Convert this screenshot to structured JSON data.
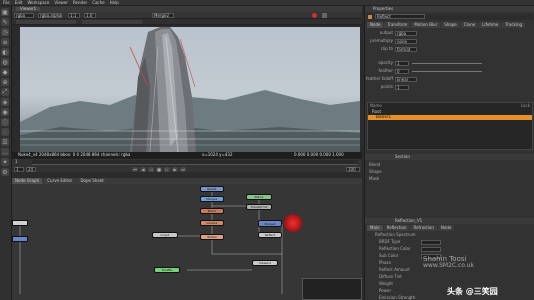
{
  "menubar": {
    "items": [
      "File",
      "Edit",
      "Workspace",
      "Viewer",
      "Render",
      "Cache",
      "Help"
    ]
  },
  "viewer": {
    "tab": "Viewer1",
    "channel_label": "rgba",
    "alpha_label": "rgba.alpha",
    "zoom_label": "1:1",
    "exposure_label": "1.0",
    "merge_label": "Merge2",
    "info_bar": "Nuke4_v4 2048x864  bbox: 0 0 2048 864 channels: rgba",
    "coords_text": "x=1024 y=432",
    "values_text": "0.000  0.000  0.000  1.000",
    "frame": "1"
  },
  "timeline": {
    "start": "1",
    "end": "100",
    "fps": "24",
    "frame_label": "frame"
  },
  "bottom_tabs": [
    "Node Graph",
    "Curve Editor",
    "Dope Sheet"
  ],
  "properties": {
    "title": "Properties",
    "node_name": "Reflect",
    "tabs": [
      "Node",
      "Transform",
      "Motion Blur",
      "Shape",
      "Clone",
      "Lifetime",
      "Tracking",
      "Node"
    ],
    "rows": [
      {
        "label": "output",
        "value": "rgba"
      },
      {
        "label": "premultiply",
        "value": "none"
      },
      {
        "label": "clip to",
        "value": "format"
      },
      {
        "label": "opacity",
        "value": "1"
      },
      {
        "label": "feather",
        "value": "0"
      },
      {
        "label": "feather falloff",
        "value": "linear"
      },
      {
        "label": "points",
        "value": "1"
      }
    ],
    "list_header": [
      "Name",
      "Lock"
    ],
    "list_items": [
      "Root",
      "Bezier1"
    ]
  },
  "sections": [
    {
      "title": "Section",
      "rows": [
        "Blend",
        "Shape",
        "Mask"
      ]
    },
    {
      "title": "Reflection_V1",
      "tabs": [
        "Main",
        "Reflection",
        "Refraction",
        "Node"
      ],
      "rows": [
        "Reflection Spectrum",
        "BRDF Type",
        "Reflection Color",
        "Sub Color",
        "Phase",
        "Reflect Amount",
        "Diffuse Tint",
        "Weight",
        "Power",
        "Emission Strength"
      ]
    }
  ],
  "watermark": {
    "line1": "Shahin Toosi",
    "line2": "www.SM2C.co.uk",
    "line3": "头条 @三笑园"
  },
  "nodes": [
    {
      "label": "Read1",
      "color": "#7a96c8"
    },
    {
      "label": "Blur1",
      "color": "#c87a5a"
    },
    {
      "label": "Merge1",
      "color": "#6fa0d8"
    },
    {
      "label": "Grade1",
      "color": "#d08a6a"
    },
    {
      "label": "Transform1",
      "color": "#b0b0b0"
    },
    {
      "label": "Roto1",
      "color": "#86c486"
    },
    {
      "label": "Merge2",
      "color": "#6a86c8"
    },
    {
      "label": "Reflect",
      "color": "#c8c8c8"
    },
    {
      "label": "Write1",
      "color": "#e0a080"
    },
    {
      "label": "Viewer1",
      "color": "#888888"
    },
    {
      "label": "Shuffle",
      "color": "#7ad07a"
    },
    {
      "label": "Crop1",
      "color": "#a0a0a0"
    }
  ]
}
